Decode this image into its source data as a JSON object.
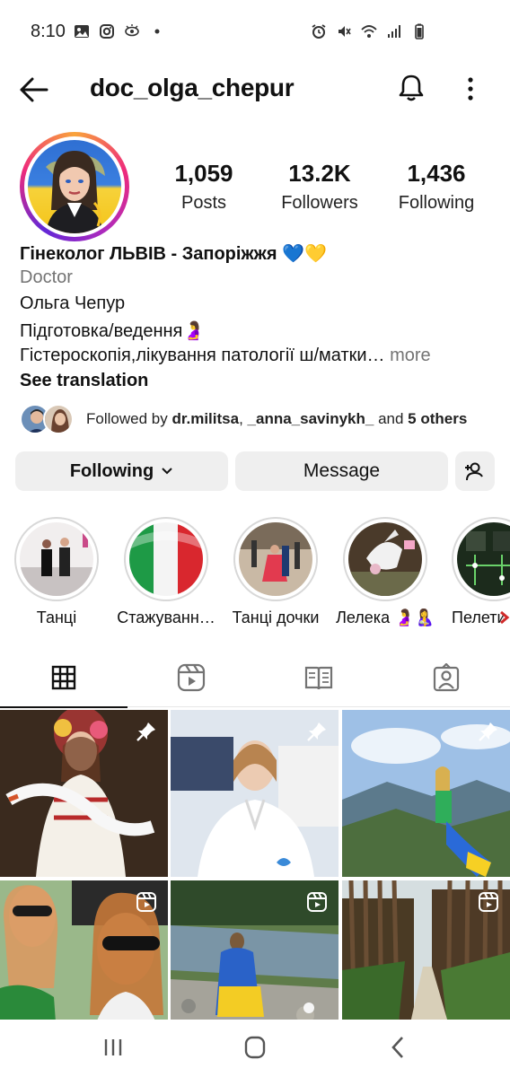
{
  "status_bar": {
    "time": "8:10",
    "left_icons": [
      "image-icon",
      "instagram-icon",
      "eye-icon",
      "dot-icon"
    ],
    "right_icons": [
      "alarm-icon",
      "mute-icon",
      "wifi-icon",
      "signal-icon",
      "battery-icon"
    ]
  },
  "header": {
    "username": "doc_olga_chepur",
    "back_icon": "arrow-left-icon",
    "bell_icon": "bell-icon",
    "menu_icon": "kebab-menu-icon"
  },
  "stats": {
    "posts_count": "1,059",
    "posts_label": "Posts",
    "followers_count": "13.2K",
    "followers_label": "Followers",
    "following_count": "1,436",
    "following_label": "Following"
  },
  "bio": {
    "name": "Гінеколог ЛЬВІВ - Запоріжжя 💙💛",
    "category": "Doctor",
    "line1": "Ольга Чепур",
    "line2": "Підготовка/ведення🤰",
    "line3": "Гістероскопія,лікування патології ш/матки…",
    "more": " more",
    "see_translation": "See translation"
  },
  "followed_by": {
    "prefix": "Followed by ",
    "user1": "dr.militsa",
    "sep": ", ",
    "user2": "_anna_savinykh_",
    "mid": " and ",
    "others": "5 others"
  },
  "buttons": {
    "following": "Following",
    "message": "Message"
  },
  "highlights": [
    {
      "label": "Танці"
    },
    {
      "label": "Стажуванн…"
    },
    {
      "label": "Танці дочки"
    },
    {
      "label": "Лелека 🤰🤱"
    },
    {
      "label": "Пелети"
    }
  ],
  "tabs": [
    {
      "icon": "grid-icon",
      "active": true
    },
    {
      "icon": "reels-icon",
      "active": false
    },
    {
      "icon": "guide-icon",
      "active": false
    },
    {
      "icon": "tagged-icon",
      "active": false
    }
  ],
  "grid": [
    {
      "badge": "pin-icon"
    },
    {
      "badge": "pin-icon"
    },
    {
      "badge": "pin-icon"
    },
    {
      "badge": "reel-icon"
    },
    {
      "badge": "reel-icon"
    },
    {
      "badge": "reel-icon"
    }
  ],
  "colors": {
    "accent_blue": "#0095f6",
    "button_gray": "#efefef",
    "text_secondary": "#737373"
  }
}
